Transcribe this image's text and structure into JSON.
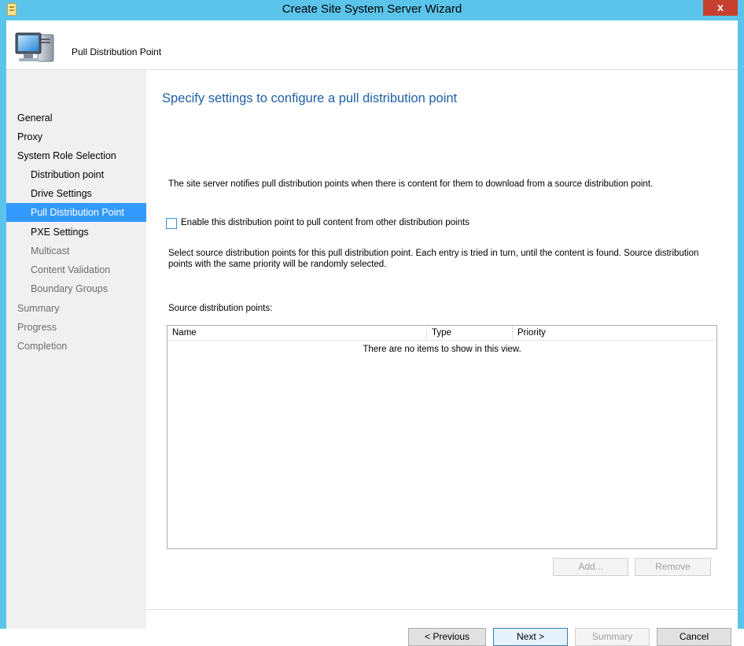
{
  "window": {
    "title": "Create Site System Server Wizard",
    "close_glyph": "x"
  },
  "header": {
    "title": "Pull Distribution Point",
    "icon": "computer-server-icon"
  },
  "nav": {
    "items": [
      {
        "label": "General",
        "level": 1,
        "state": "normal"
      },
      {
        "label": "Proxy",
        "level": 1,
        "state": "normal"
      },
      {
        "label": "System Role Selection",
        "level": 1,
        "state": "normal"
      },
      {
        "label": "Distribution point",
        "level": 2,
        "state": "normal"
      },
      {
        "label": "Drive Settings",
        "level": 2,
        "state": "normal"
      },
      {
        "label": "Pull Distribution Point",
        "level": 2,
        "state": "selected"
      },
      {
        "label": "PXE Settings",
        "level": 2,
        "state": "normal"
      },
      {
        "label": "Multicast",
        "level": 2,
        "state": "disabled"
      },
      {
        "label": "Content Validation",
        "level": 2,
        "state": "disabled"
      },
      {
        "label": "Boundary Groups",
        "level": 2,
        "state": "disabled"
      },
      {
        "label": "Summary",
        "level": 1,
        "state": "disabled"
      },
      {
        "label": "Progress",
        "level": 1,
        "state": "disabled"
      },
      {
        "label": "Completion",
        "level": 1,
        "state": "disabled"
      }
    ]
  },
  "main": {
    "heading": "Specify settings to configure a pull distribution point",
    "notice": "The site server notifies pull distribution points when there is content for them to download from a source distribution point.",
    "checkbox": {
      "label": "Enable this distribution point to pull content from other distribution points",
      "checked": false
    },
    "description": "Select source distribution points for this pull distribution point. Each entry is tried in turn, until the content is found. Source distribution points with the same priority will be randomly selected.",
    "list_label": "Source distribution points:",
    "list": {
      "columns": [
        "Name",
        "Type",
        "Priority"
      ],
      "empty_text": "There are no items to show in this view."
    },
    "add_button": "Add...",
    "remove_button": "Remove"
  },
  "footer": {
    "previous": "< Previous",
    "next": "Next >",
    "summary": "Summary",
    "cancel": "Cancel"
  },
  "colors": {
    "title_bar": "#5bc4ea",
    "selected_nav": "#3399ff",
    "heading": "#1f5fa5",
    "close_button": "#c7402f"
  }
}
